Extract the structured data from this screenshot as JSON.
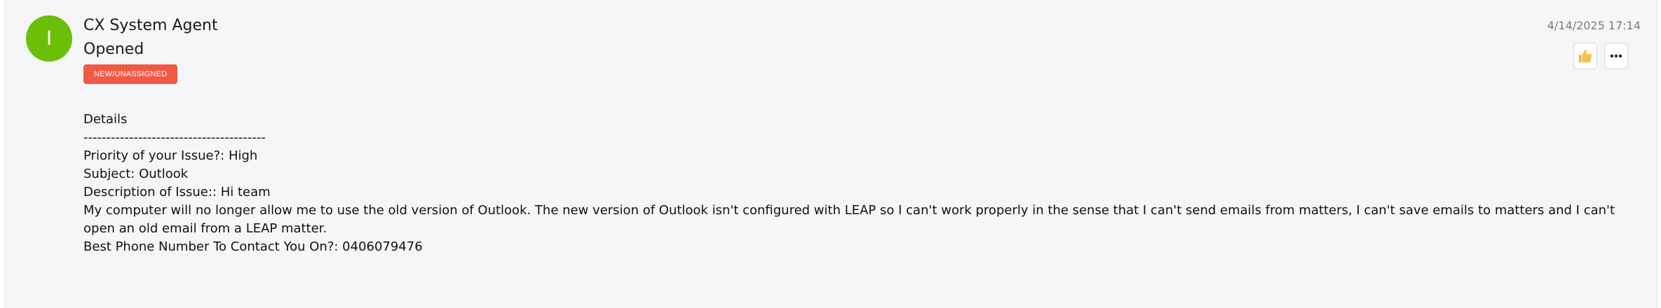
{
  "entry": {
    "avatar_initial": "I",
    "author": "CX System Agent",
    "action": "Opened",
    "status_badge": "NEW/UNASSIGNED",
    "timestamp": "4/14/2025 17:14",
    "like_icon": "thumbs-up-icon",
    "more_icon": "more-horizontal-icon",
    "colors": {
      "avatar": "#6cbf07",
      "badge": "#f05a45",
      "card_background": "#f5f6f8"
    }
  },
  "details": {
    "heading": "Details",
    "divider": "----------------------------------------",
    "priority": "Priority of your Issue?: High",
    "subject": "Subject: Outlook",
    "description_label": "Description of Issue:: Hi team",
    "description_body": "My computer will no longer allow me to use the old version of Outlook. The new version of Outlook isn't configured with LEAP so I can't work properly in the sense that I can't send emails from matters, I can't save emails to matters and I can't open an old email from a LEAP matter.",
    "phone": "Best Phone Number To Contact You On?: 0406079476"
  }
}
